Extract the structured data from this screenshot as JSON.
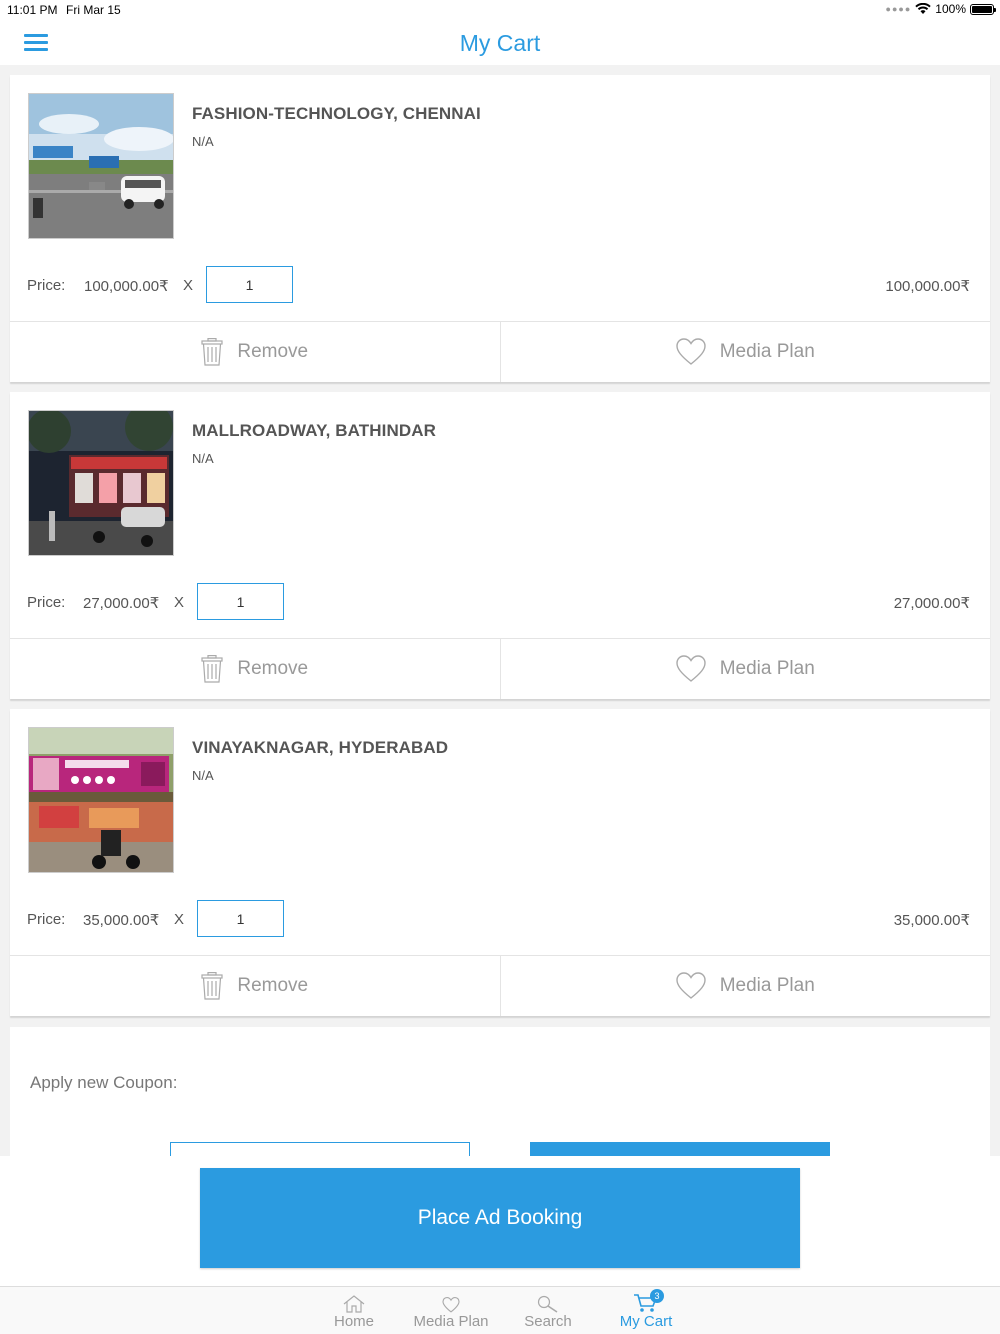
{
  "status_bar": {
    "time": "11:01 PM",
    "date": "Fri Mar 15",
    "battery": "100%"
  },
  "header": {
    "title": "My Cart"
  },
  "cart": {
    "price_label": "Price:",
    "times": "X",
    "remove_label": "Remove",
    "media_plan_label": "Media Plan",
    "items": [
      {
        "title": "FASHION-TECHNOLOGY, CHENNAI",
        "subtitle": "N/A",
        "price": "100,000.00₹",
        "quantity": "1",
        "total": "100,000.00₹"
      },
      {
        "title": "MALLROADWAY, BATHINDAR",
        "subtitle": "N/A",
        "price": "27,000.00₹",
        "quantity": "1",
        "total": "27,000.00₹"
      },
      {
        "title": "VINAYAKNAGAR, HYDERABAD",
        "subtitle": "N/A",
        "price": "35,000.00₹",
        "quantity": "1",
        "total": "35,000.00₹"
      }
    ]
  },
  "coupon": {
    "label": "Apply new Coupon:"
  },
  "place_booking": {
    "label": "Place Ad Booking"
  },
  "tab_bar": {
    "tabs": [
      {
        "label": "Home",
        "icon": "home-icon"
      },
      {
        "label": "Media Plan",
        "icon": "heart-icon"
      },
      {
        "label": "Search",
        "icon": "search-icon"
      },
      {
        "label": "My Cart",
        "icon": "cart-icon",
        "badge": "3",
        "active": true
      }
    ]
  },
  "colors": {
    "accent": "#2b9be0",
    "background": "#f2f2f2"
  }
}
